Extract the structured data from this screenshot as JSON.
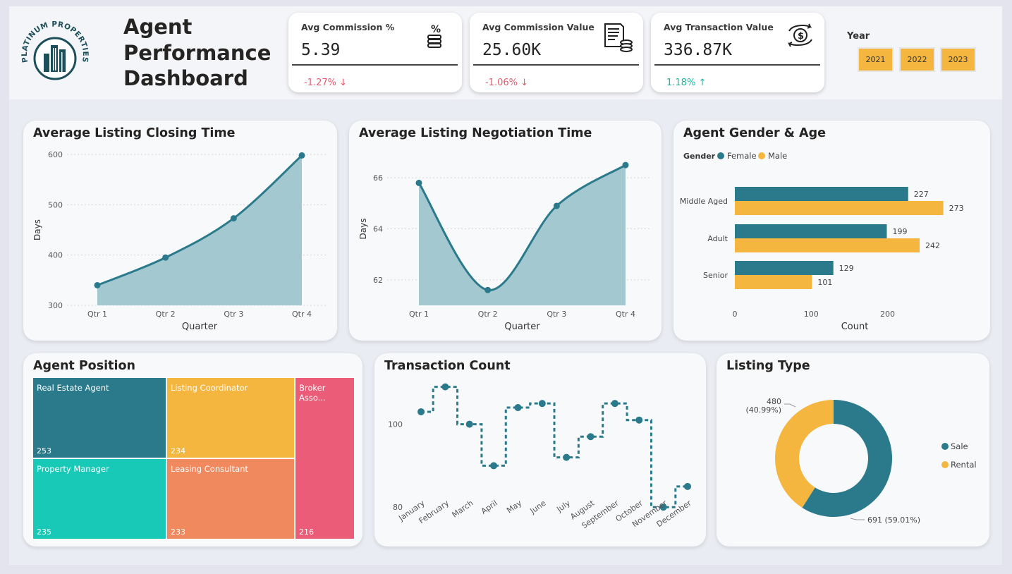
{
  "header": {
    "title": "Agent Performance Dashboard",
    "logo_text": "PLATINUM PROPERTIES"
  },
  "kpis": [
    {
      "label": "Avg Commission %",
      "value": "5.39",
      "delta": "-1.27%",
      "direction": "down",
      "icon": "percent-coins-icon"
    },
    {
      "label": "Avg Commission Value",
      "value": "25.60K",
      "delta": "-1.06%",
      "direction": "down",
      "icon": "invoice-coins-icon"
    },
    {
      "label": "Avg Transaction Value",
      "value": "336.87K",
      "delta": "1.18%",
      "direction": "up",
      "icon": "money-exchange-icon"
    }
  ],
  "year_filter": {
    "label": "Year",
    "options": [
      "2021",
      "2022",
      "2023"
    ]
  },
  "colors": {
    "teal": "#2b7a8b",
    "area": "#a4c8d0",
    "gold": "#f5b63f",
    "turquoise": "#17c9b6",
    "orange": "#f0895e",
    "pink": "#ea5c78",
    "negative": "#e45a6e",
    "positive": "#1ab7a0"
  },
  "chart_data": [
    {
      "id": "closing",
      "type": "area",
      "title": "Average Listing Closing Time",
      "xlabel": "Quarter",
      "ylabel": "Days",
      "categories": [
        "Qtr 1",
        "Qtr 2",
        "Qtr 3",
        "Qtr 4"
      ],
      "values": [
        340,
        395,
        473,
        598
      ],
      "ylim": [
        300,
        600
      ],
      "yticks": [
        300,
        400,
        500,
        600
      ],
      "grid": true
    },
    {
      "id": "negotiation",
      "type": "area",
      "title": "Average Listing Negotiation Time",
      "xlabel": "Quarter",
      "ylabel": "Days",
      "categories": [
        "Qtr 1",
        "Qtr 2",
        "Qtr 3",
        "Qtr 4"
      ],
      "values": [
        65.8,
        61.6,
        64.9,
        66.5
      ],
      "ylim": [
        61,
        67
      ],
      "yticks": [
        62,
        64,
        66
      ],
      "grid": true
    },
    {
      "id": "gender_age",
      "type": "bar",
      "orientation": "horizontal",
      "title": "Agent Gender & Age",
      "legend_title": "Gender",
      "xlabel": "Count",
      "categories": [
        "Middle Aged",
        "Adult",
        "Senior"
      ],
      "series": [
        {
          "name": "Female",
          "values": [
            227,
            199,
            129
          ]
        },
        {
          "name": "Male",
          "values": [
            273,
            242,
            101
          ]
        }
      ],
      "xlim": [
        0,
        290
      ],
      "xticks": [
        0,
        100,
        200
      ],
      "legend_position": "top-left"
    },
    {
      "id": "position",
      "type": "treemap",
      "title": "Agent Position",
      "items": [
        {
          "label": "Real Estate Agent",
          "value": 253
        },
        {
          "label": "Listing Coordinator",
          "value": 234
        },
        {
          "label": "Broker Asso...",
          "value": 216
        },
        {
          "label": "Property Manager",
          "value": 235
        },
        {
          "label": "Leasing Consultant",
          "value": 233
        }
      ]
    },
    {
      "id": "transactions",
      "type": "line",
      "title": "Transaction Count",
      "style": "dashed-step",
      "categories": [
        "January",
        "February",
        "March",
        "April",
        "May",
        "June",
        "July",
        "August",
        "September",
        "October",
        "November",
        "December"
      ],
      "values": [
        103,
        109,
        100,
        90,
        104,
        105,
        92,
        97,
        105,
        101,
        80,
        85
      ],
      "ylim": [
        78,
        112
      ],
      "yticks": [
        80,
        100
      ]
    },
    {
      "id": "listing_type",
      "type": "pie",
      "style": "donut",
      "title": "Listing Type",
      "slices": [
        {
          "name": "Sale",
          "value": 691,
          "label": "691 (59.01%)"
        },
        {
          "name": "Rental",
          "value": 480,
          "label_line1": "480",
          "label_line2": "(40.99%)"
        }
      ],
      "legend_position": "right"
    }
  ]
}
